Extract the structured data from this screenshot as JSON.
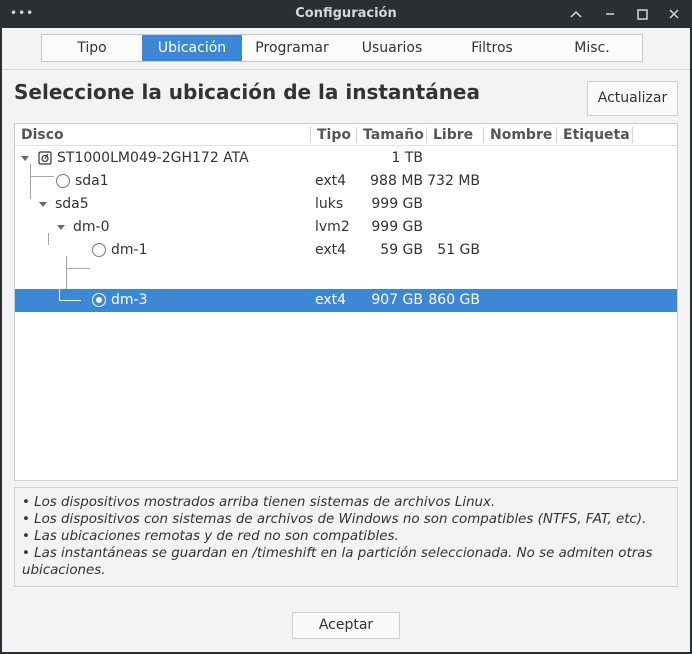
{
  "window": {
    "title": "Configuración"
  },
  "tabs": [
    {
      "label": "Tipo",
      "active": false
    },
    {
      "label": "Ubicación",
      "active": true
    },
    {
      "label": "Programar",
      "active": false
    },
    {
      "label": "Usuarios",
      "active": false
    },
    {
      "label": "Filtros",
      "active": false
    },
    {
      "label": "Misc.",
      "active": false
    }
  ],
  "main": {
    "heading": "Seleccione la ubicación de la instantánea",
    "refresh_label": "Actualizar"
  },
  "tree": {
    "columns": [
      "Disco",
      "Tipo",
      "Tamaño",
      "Libre",
      "Nombre",
      "Etiqueta"
    ],
    "rows": [
      {
        "device": "ST1000LM049-2GH172 ATA",
        "type": "",
        "size": "1 TB",
        "free": "",
        "name": "",
        "label": "",
        "icon": "disk-icon",
        "expander": "expanded-arrow"
      },
      {
        "device": "sda1",
        "type": "ext4",
        "size": "988 MB",
        "free": "732 MB",
        "name": "",
        "label": "",
        "icon": "radio-unchecked"
      },
      {
        "device": "sda5",
        "type": "luks",
        "size": "999 GB",
        "free": "",
        "name": "",
        "label": "",
        "expander": "expanded-arrow"
      },
      {
        "device": "dm-0",
        "type": "lvm2",
        "size": "999 GB",
        "free": "",
        "name": "",
        "label": "",
        "expander": "expanded-arrow"
      },
      {
        "device": "dm-1",
        "type": "ext4",
        "size": "59 GB",
        "free": "51 GB",
        "name": "",
        "label": "",
        "icon": "radio-unchecked"
      },
      {
        "device": "dm-3",
        "type": "ext4",
        "size": "907 GB",
        "free": "860 GB",
        "name": "",
        "label": "",
        "icon": "radio-checked",
        "selected": true
      }
    ]
  },
  "notes": [
    "• Los dispositivos mostrados arriba tienen sistemas de archivos Linux.",
    "• Los dispositivos con sistemas de archivos de Windows no son compatibles (NTFS, FAT, etc).",
    "• Las ubicaciones remotas y de red no son compatibles.",
    "• Las instantáneas se guardan en /timeshift en la partición seleccionada. No se admiten otras ubicaciones."
  ],
  "footer": {
    "ok_label": "Aceptar"
  },
  "colors": {
    "accent": "#3d88d6",
    "titlebar": "#2b2e33",
    "background": "#f3f3f3"
  }
}
